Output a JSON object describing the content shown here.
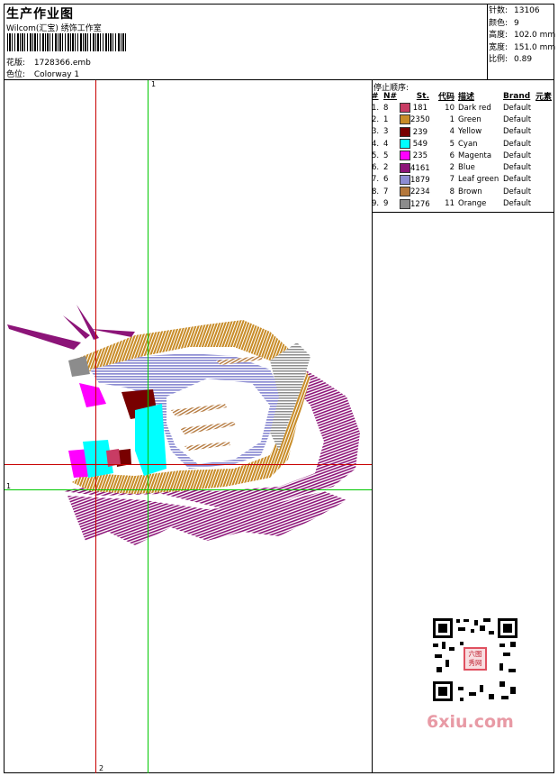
{
  "header": {
    "title": "生产作业图",
    "subtitle": "Wilcom(汇宝) 绣饰工作室",
    "design_label": "花版:",
    "design_value": "1728366.emb",
    "colorway_label": "色位:",
    "colorway_value": "Colorway 1"
  },
  "stats": [
    {
      "label": "针数:",
      "value": "13106"
    },
    {
      "label": "颜色:",
      "value": "9"
    },
    {
      "label": "高度:",
      "value": "102.0 mm"
    },
    {
      "label": "宽度:",
      "value": "151.0 mm"
    },
    {
      "label": "比例:",
      "value": "0.89"
    }
  ],
  "stop_sequence": {
    "title": "停止顺序:",
    "headers": [
      "#",
      "N#",
      "St.",
      "代码",
      "描述",
      "Brand",
      "元素"
    ],
    "rows": [
      {
        "idx": "1.",
        "n": "8",
        "color": "#c83c64",
        "st": "181",
        "code": "10",
        "desc": "Dark red",
        "brand": "Default"
      },
      {
        "idx": "2.",
        "n": "1",
        "color": "#c88c28",
        "st": "2350",
        "code": "1",
        "desc": "Green",
        "brand": "Default"
      },
      {
        "idx": "3.",
        "n": "3",
        "color": "#780000",
        "st": "239",
        "code": "4",
        "desc": "Yellow",
        "brand": "Default"
      },
      {
        "idx": "4.",
        "n": "4",
        "color": "#00ffff",
        "st": "549",
        "code": "5",
        "desc": "Cyan",
        "brand": "Default"
      },
      {
        "idx": "5.",
        "n": "5",
        "color": "#ff00ff",
        "st": "235",
        "code": "6",
        "desc": "Magenta",
        "brand": "Default"
      },
      {
        "idx": "6.",
        "n": "2",
        "color": "#8c1478",
        "st": "4161",
        "code": "2",
        "desc": "Blue",
        "brand": "Default"
      },
      {
        "idx": "7.",
        "n": "6",
        "color": "#8c8cd2",
        "st": "1879",
        "code": "7",
        "desc": "Leaf green",
        "brand": "Default"
      },
      {
        "idx": "8.",
        "n": "7",
        "color": "#b4783c",
        "st": "2234",
        "code": "8",
        "desc": "Brown",
        "brand": "Default"
      },
      {
        "idx": "9.",
        "n": "9",
        "color": "#8c8c8c",
        "st": "1276",
        "code": "11",
        "desc": "Orange",
        "brand": "Default"
      }
    ]
  },
  "guides": {
    "green_v_label": "1",
    "green_h_label": "1",
    "red_v_label": "2"
  },
  "watermark": {
    "text": "6xiu.com",
    "qr_badge": "六图秀网"
  }
}
